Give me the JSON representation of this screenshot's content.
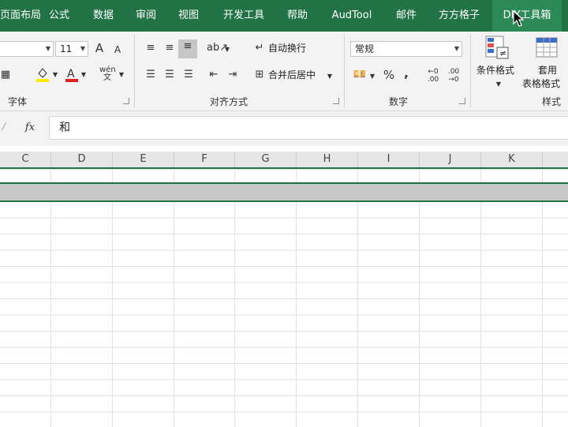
{
  "menu_tabs": [
    "页面布局",
    "公式",
    "数据",
    "审阅",
    "视图",
    "开发工具",
    "帮助",
    "AudTool",
    "邮件",
    "方方格子",
    "DIY工具箱"
  ],
  "ribbon": {
    "font_size": "11",
    "grow_font": "A",
    "shrink_font": "A",
    "wrap_text": "自动换行",
    "merge_center": "合并后居中",
    "number_format": "常规",
    "percent": "%",
    "comma": ",",
    "conditional_format": "条件格式",
    "table_format_1": "套用",
    "table_format_2": "表格格式",
    "groups": {
      "font": "字体",
      "align": "对齐方式",
      "number": "数字",
      "styles": "样式"
    }
  },
  "formula_bar": {
    "fx": "fx",
    "value": "和"
  },
  "columns": [
    "C",
    "D",
    "E",
    "F",
    "G",
    "H",
    "I",
    "J",
    "K"
  ],
  "colors": {
    "accent": "#217346",
    "selection": "#c8c8c8"
  }
}
